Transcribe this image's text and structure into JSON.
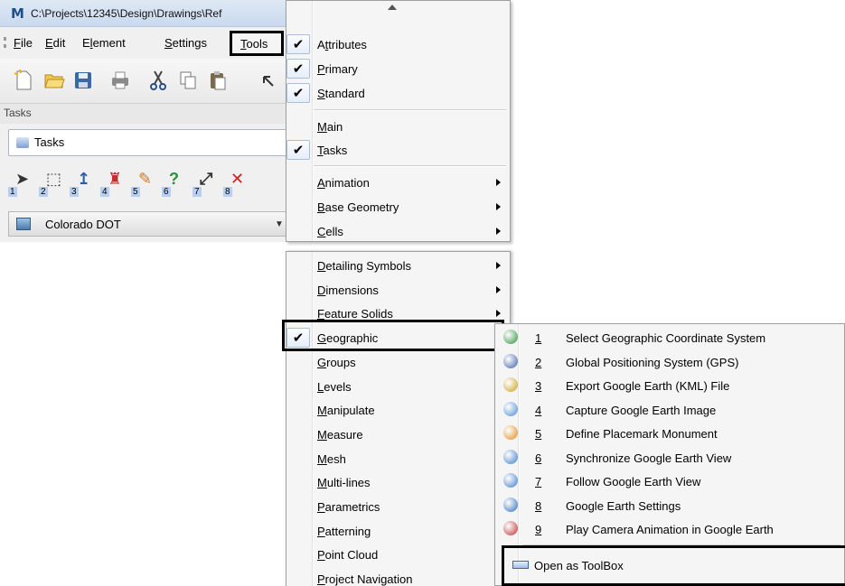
{
  "window": {
    "title": "C:\\Projects\\12345\\Design\\Drawings\\Ref"
  },
  "menubar": {
    "items": [
      {
        "label": "File",
        "u": "F"
      },
      {
        "label": "Edit",
        "u": "E"
      },
      {
        "label": "Element",
        "u": "l"
      },
      {
        "label": "Settings",
        "u": "S"
      },
      {
        "label": "Tools",
        "u": "T"
      }
    ]
  },
  "toolbar": {
    "icons": [
      "new-file-icon",
      "open-folder-icon",
      "save-icon",
      "print-icon",
      "cut-icon",
      "copy-icon",
      "paste-icon",
      "undo-icon"
    ]
  },
  "tasks": {
    "header": "Tasks",
    "selector": "Tasks",
    "tools": [
      {
        "num": "1",
        "icon": "element-selection-icon"
      },
      {
        "num": "2",
        "icon": "fence-icon"
      },
      {
        "num": "3",
        "icon": "move-icon"
      },
      {
        "num": "4",
        "icon": "change-attributes-icon"
      },
      {
        "num": "5",
        "icon": "match-attributes-icon"
      },
      {
        "num": "6",
        "icon": "query-icon"
      },
      {
        "num": "7",
        "icon": "scale-icon"
      },
      {
        "num": "8",
        "icon": "delete-icon"
      }
    ],
    "workflow": "Colorado DOT"
  },
  "tools_menu": {
    "top": [
      {
        "label": "Attributes",
        "u": "t",
        "checked": true
      },
      {
        "label": "Primary",
        "u": "P",
        "checked": true
      },
      {
        "label": "Standard",
        "u": "S",
        "checked": true
      },
      {
        "label": "Main",
        "u": "M",
        "checked": false
      },
      {
        "label": "Tasks",
        "u": "T",
        "checked": true
      },
      {
        "label": "Animation",
        "u": "A",
        "checked": false,
        "sub": true
      },
      {
        "label": "Base Geometry",
        "u": "B",
        "checked": false,
        "sub": true
      },
      {
        "label": "Cells",
        "u": "C",
        "checked": false,
        "sub": true
      }
    ],
    "bottom": [
      {
        "label": "Detailing Symbols",
        "u": "D",
        "checked": false,
        "sub": true
      },
      {
        "label": "Dimensions",
        "u": "D",
        "checked": false,
        "sub": true
      },
      {
        "label": "Feature Solids",
        "u": "F",
        "checked": false,
        "sub": true
      },
      {
        "label": "Geographic",
        "u": "G",
        "checked": true,
        "sub": true
      },
      {
        "label": "Groups",
        "u": "G",
        "checked": false,
        "sub": true
      },
      {
        "label": "Levels",
        "u": "L",
        "checked": false,
        "sub": true
      },
      {
        "label": "Manipulate",
        "u": "M",
        "checked": false,
        "sub": true
      },
      {
        "label": "Measure",
        "u": "M",
        "checked": false,
        "sub": true
      },
      {
        "label": "Mesh",
        "u": "M",
        "checked": false,
        "sub": true
      },
      {
        "label": "Multi-lines",
        "u": "M",
        "checked": false,
        "sub": true
      },
      {
        "label": "Parametrics",
        "u": "P",
        "checked": false,
        "sub": true
      },
      {
        "label": "Patterning",
        "u": "P",
        "checked": false,
        "sub": true
      },
      {
        "label": "Point Cloud",
        "u": "P",
        "checked": false,
        "sub": true
      },
      {
        "label": "Project Navigation",
        "u": "P",
        "checked": false,
        "sub": true
      }
    ]
  },
  "geographic_menu": {
    "items": [
      {
        "num": "1",
        "label": "Select Geographic Coordinate System",
        "icon": "globe-grid-icon",
        "color": "#2f8f3a"
      },
      {
        "num": "2",
        "label": "Global Positioning System (GPS)",
        "icon": "satellite-icon",
        "color": "#3a5fa8"
      },
      {
        "num": "3",
        "label": "Export Google Earth (KML) File",
        "icon": "kml-export-icon",
        "color": "#c8a020"
      },
      {
        "num": "4",
        "label": "Capture Google Earth Image",
        "icon": "earth-capture-icon",
        "color": "#4a8ad0"
      },
      {
        "num": "5",
        "label": "Define Placemark Monument",
        "icon": "placemark-icon",
        "color": "#e08a1c"
      },
      {
        "num": "6",
        "label": "Synchronize Google Earth View",
        "icon": "sync-view-icon",
        "color": "#3c7cc8"
      },
      {
        "num": "7",
        "label": "Follow Google Earth View",
        "icon": "follow-view-icon",
        "color": "#3c7cc8"
      },
      {
        "num": "8",
        "label": "Google Earth Settings",
        "icon": "earth-settings-icon",
        "color": "#2b6fb8"
      },
      {
        "num": "9",
        "label": "Play Camera Animation in Google Earth",
        "icon": "camera-animation-icon",
        "color": "#c03030"
      }
    ],
    "toolbox_label": "Open as ToolBox"
  }
}
